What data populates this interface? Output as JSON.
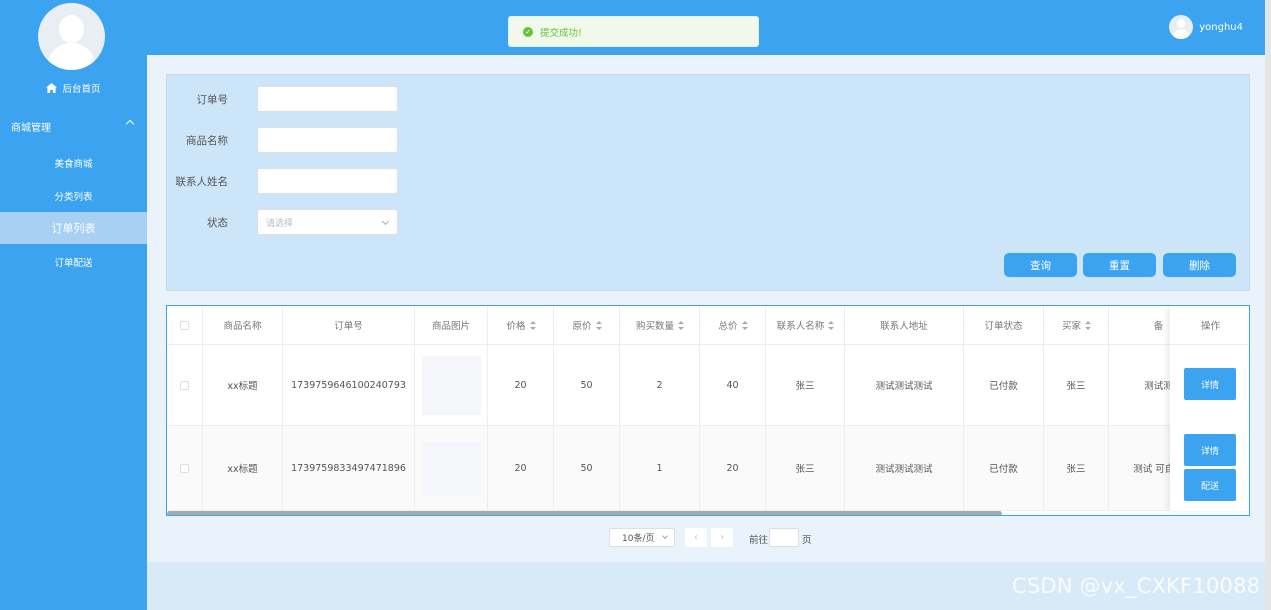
{
  "sidebar": {
    "home_label": "后台首页",
    "group_label": "商城管理",
    "items": [
      {
        "label": "美食商城"
      },
      {
        "label": "分类列表"
      },
      {
        "label": "订单列表",
        "active": true
      },
      {
        "label": "订单配送"
      }
    ]
  },
  "header": {
    "username": "yonghu4"
  },
  "toast": {
    "message": "提交成功!"
  },
  "search": {
    "order_no_label": "订单号",
    "product_name_label": "商品名称",
    "contact_name_label": "联系人姓名",
    "status_label": "状态",
    "status_placeholder": "请选择",
    "query_button": "查询",
    "reset_button": "重置",
    "delete_button": "删除"
  },
  "table": {
    "headers": {
      "product_name": "商品名称",
      "order_no": "订单号",
      "product_image": "商品图片",
      "price": "价格",
      "original_price": "原价",
      "quantity": "购买数量",
      "total": "总价",
      "contact_name": "联系人名称",
      "contact_address": "联系人地址",
      "order_status": "订单状态",
      "buyer": "买家",
      "remark": "备",
      "actions": "操作"
    },
    "rows": [
      {
        "product_name": "xx标题",
        "order_no": "1739759646100240793",
        "price": "20",
        "original_price": "50",
        "quantity": "2",
        "total": "40",
        "contact_name": "张三",
        "contact_address": "测试测试测试",
        "order_status": "已付款",
        "buyer": "张三",
        "remark": "测试测",
        "actions": [
          "详情"
        ]
      },
      {
        "product_name": "xx标题",
        "order_no": "1739759833497471896",
        "price": "20",
        "original_price": "50",
        "quantity": "1",
        "total": "20",
        "contact_name": "张三",
        "contact_address": "测试测试测试",
        "order_status": "已付款",
        "buyer": "张三",
        "remark": "测试 可自行",
        "actions": [
          "详情",
          "配送"
        ]
      }
    ]
  },
  "pagination": {
    "page_size": "10条/页",
    "prev": "‹",
    "next": "›",
    "goto_label": "前往",
    "page_unit": "页"
  },
  "watermark": "CSDN @vx_CXKF10088",
  "colors": {
    "primary": "#3ba3f0",
    "sidebar_active": "#a7d0f3",
    "panel": "#cde5f8",
    "success": "#67c23a"
  }
}
